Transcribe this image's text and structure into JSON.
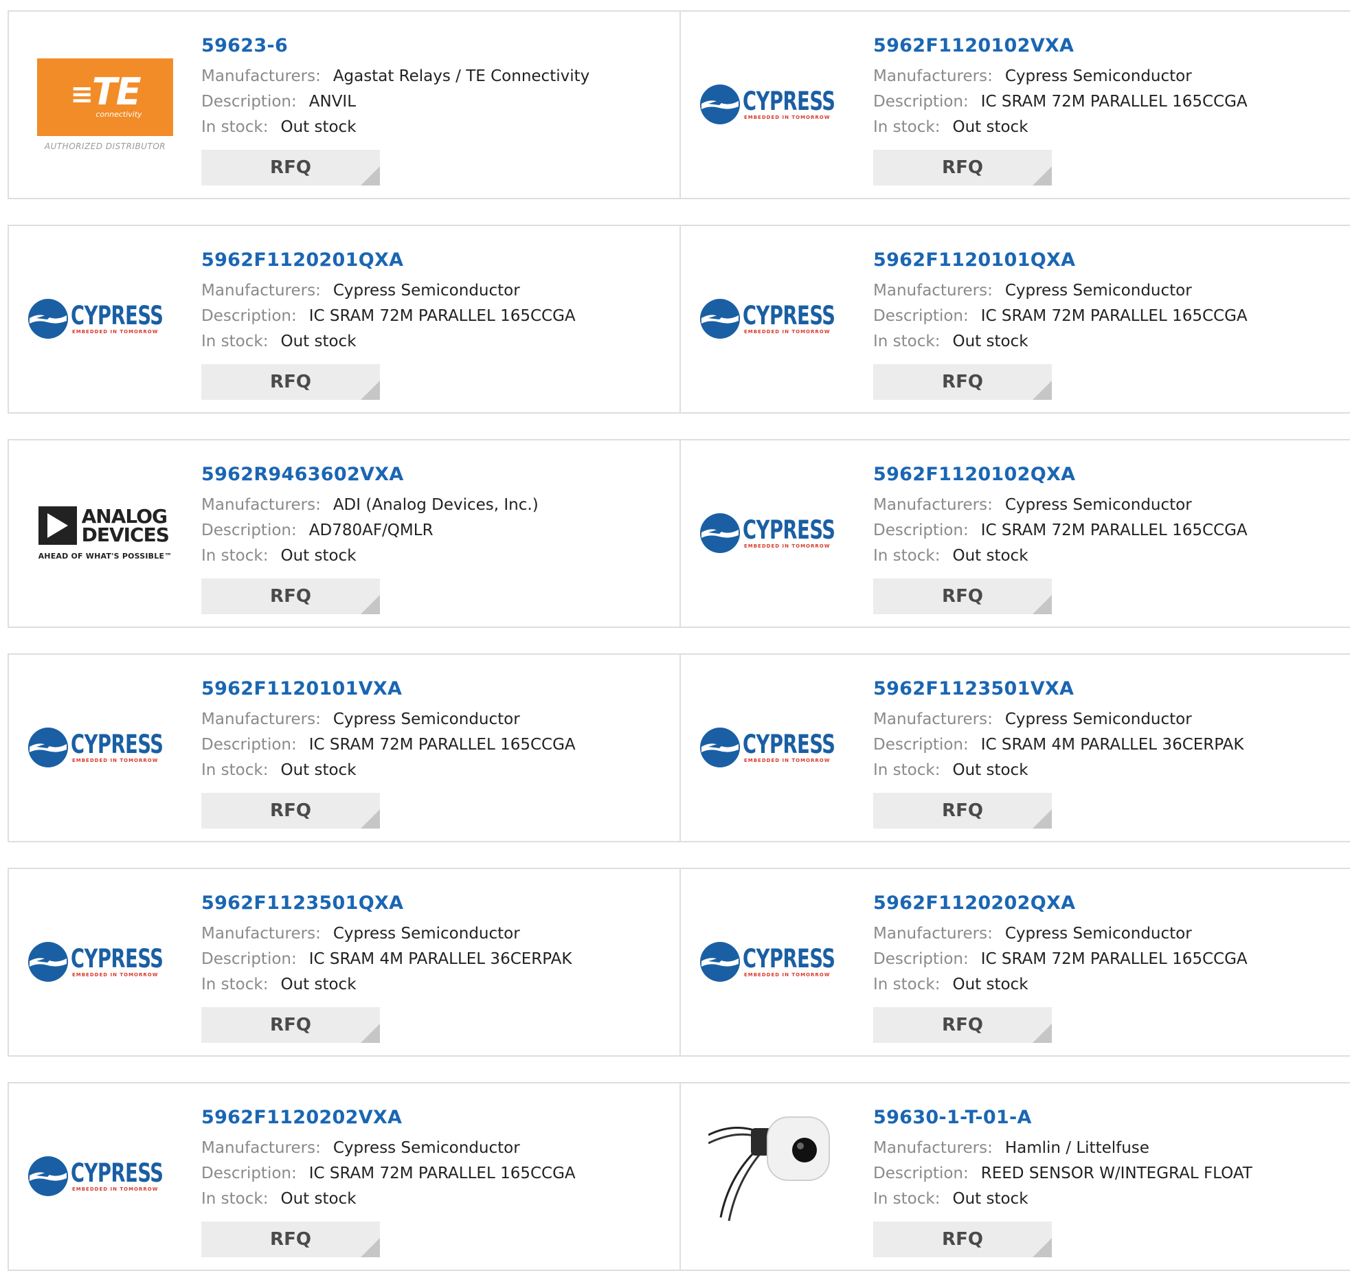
{
  "labels": {
    "manufacturers": "Manufacturers:",
    "description": "Description:",
    "in_stock": "In stock:",
    "rfq": "RFQ"
  },
  "logos": {
    "te_mark": "TE",
    "te_sub": "connectivity",
    "te_authorized": "AUTHORIZED DISTRIBUTOR",
    "cypress_word": "CYPRESS",
    "cypress_tag": "EMBEDDED IN TOMORROW",
    "adi_line1": "ANALOG",
    "adi_line2": "DEVICES",
    "adi_tag": "AHEAD OF WHAT'S POSSIBLE™"
  },
  "products": [
    {
      "part_number": "59623-6",
      "manufacturer": "Agastat Relays / TE Connectivity",
      "description": "ANVIL",
      "stock": "Out stock",
      "logo": "te-connectivity-logo"
    },
    {
      "part_number": "5962F1120102VXA",
      "manufacturer": "Cypress Semiconductor",
      "description": "IC SRAM 72M PARALLEL 165CCGA",
      "stock": "Out stock",
      "logo": "cypress-logo"
    },
    {
      "part_number": "5962F1120201QXA",
      "manufacturer": "Cypress Semiconductor",
      "description": "IC SRAM 72M PARALLEL 165CCGA",
      "stock": "Out stock",
      "logo": "cypress-logo"
    },
    {
      "part_number": "5962F1120101QXA",
      "manufacturer": "Cypress Semiconductor",
      "description": "IC SRAM 72M PARALLEL 165CCGA",
      "stock": "Out stock",
      "logo": "cypress-logo"
    },
    {
      "part_number": "5962R9463602VXA",
      "manufacturer": "ADI (Analog Devices, Inc.)",
      "description": "AD780AF/QMLR",
      "stock": "Out stock",
      "logo": "analog-devices-logo"
    },
    {
      "part_number": "5962F1120102QXA",
      "manufacturer": "Cypress Semiconductor",
      "description": "IC SRAM 72M PARALLEL 165CCGA",
      "stock": "Out stock",
      "logo": "cypress-logo"
    },
    {
      "part_number": "5962F1120101VXA",
      "manufacturer": "Cypress Semiconductor",
      "description": "IC SRAM 72M PARALLEL 165CCGA",
      "stock": "Out stock",
      "logo": "cypress-logo"
    },
    {
      "part_number": "5962F1123501VXA",
      "manufacturer": "Cypress Semiconductor",
      "description": "IC SRAM 4M PARALLEL 36CERPAK",
      "stock": "Out stock",
      "logo": "cypress-logo"
    },
    {
      "part_number": "5962F1123501QXA",
      "manufacturer": "Cypress Semiconductor",
      "description": "IC SRAM 4M PARALLEL 36CERPAK",
      "stock": "Out stock",
      "logo": "cypress-logo"
    },
    {
      "part_number": "5962F1120202QXA",
      "manufacturer": "Cypress Semiconductor",
      "description": "IC SRAM 72M PARALLEL 165CCGA",
      "stock": "Out stock",
      "logo": "cypress-logo"
    },
    {
      "part_number": "5962F1120202VXA",
      "manufacturer": "Cypress Semiconductor",
      "description": "IC SRAM 72M PARALLEL 165CCGA",
      "stock": "Out stock",
      "logo": "cypress-logo"
    },
    {
      "part_number": "59630-1-T-01-A",
      "manufacturer": "Hamlin / Littelfuse",
      "description": "REED SENSOR W/INTEGRAL FLOAT",
      "stock": "Out stock",
      "logo": "reed-sensor-photo"
    }
  ],
  "colors": {
    "part_number": "#1a66b3",
    "label": "#8a8a8a",
    "value": "#222222",
    "rfq_bg": "#ececec",
    "te_orange": "#f28c28",
    "cypress_blue": "#1a5fa3"
  }
}
